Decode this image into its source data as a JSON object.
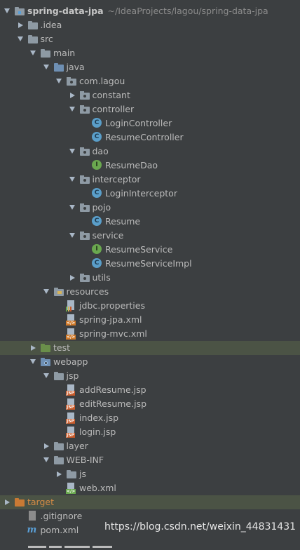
{
  "project": {
    "name": "spring-data-jpa",
    "path": "~/IdeaProjects/lagou/spring-data-jpa"
  },
  "items": [
    {
      "label": ".idea",
      "icon": "folder-icon",
      "expanded": false
    },
    {
      "label": "src",
      "icon": "folder-icon",
      "expanded": true
    },
    {
      "label": "main",
      "icon": "folder-icon",
      "expanded": true
    },
    {
      "label": "java",
      "icon": "source-folder-icon",
      "expanded": true
    },
    {
      "label": "com.lagou",
      "icon": "package-icon",
      "expanded": true
    },
    {
      "label": "constant",
      "icon": "package-icon",
      "expanded": false
    },
    {
      "label": "controller",
      "icon": "package-icon",
      "expanded": true
    },
    {
      "label": "LoginController",
      "icon": "class-icon",
      "badge": "C"
    },
    {
      "label": "ResumeController",
      "icon": "class-icon",
      "badge": "C"
    },
    {
      "label": "dao",
      "icon": "package-icon",
      "expanded": true
    },
    {
      "label": "ResumeDao",
      "icon": "interface-icon",
      "badge": "I"
    },
    {
      "label": "interceptor",
      "icon": "package-icon",
      "expanded": true
    },
    {
      "label": "LoginInterceptor",
      "icon": "class-icon",
      "badge": "C"
    },
    {
      "label": "pojo",
      "icon": "package-icon",
      "expanded": true
    },
    {
      "label": "Resume",
      "icon": "class-icon",
      "badge": "C"
    },
    {
      "label": "service",
      "icon": "package-icon",
      "expanded": true
    },
    {
      "label": "ResumeService",
      "icon": "interface-icon",
      "badge": "I"
    },
    {
      "label": "ResumeServiceImpl",
      "icon": "class-icon",
      "badge": "C"
    },
    {
      "label": "utils",
      "icon": "package-icon",
      "expanded": false
    },
    {
      "label": "resources",
      "icon": "resources-folder-icon",
      "expanded": true
    },
    {
      "label": "jdbc.properties",
      "icon": "properties-file-icon"
    },
    {
      "label": "spring-jpa.xml",
      "icon": "spring-xml-file-icon",
      "tag": "</>"
    },
    {
      "label": "spring-mvc.xml",
      "icon": "spring-xml-file-icon",
      "tag": "</>"
    },
    {
      "label": "test",
      "icon": "test-folder-icon",
      "expanded": false
    },
    {
      "label": "webapp",
      "icon": "web-folder-icon",
      "expanded": true
    },
    {
      "label": "jsp",
      "icon": "folder-icon",
      "expanded": true
    },
    {
      "label": "addResume.jsp",
      "icon": "jsp-file-icon",
      "tag": "JSP"
    },
    {
      "label": "editResume.jsp",
      "icon": "jsp-file-icon",
      "tag": "JSP"
    },
    {
      "label": "index.jsp",
      "icon": "jsp-file-icon",
      "tag": "JSP"
    },
    {
      "label": "login.jsp",
      "icon": "jsp-file-icon",
      "tag": "JSP"
    },
    {
      "label": "layer",
      "icon": "folder-icon",
      "expanded": false
    },
    {
      "label": "WEB-INF",
      "icon": "folder-icon",
      "expanded": true
    },
    {
      "label": "js",
      "icon": "folder-icon",
      "expanded": false
    },
    {
      "label": "web.xml",
      "icon": "web-xml-file-icon",
      "tag": "</>"
    },
    {
      "label": "target",
      "icon": "excluded-folder-icon",
      "expanded": false
    },
    {
      "label": ".gitignore",
      "icon": "gitignore-file-icon"
    },
    {
      "label": "pom.xml",
      "icon": "maven-pom-icon",
      "badge": "m"
    }
  ],
  "watermark": "https://blog.csdn.net/weixin_44831431",
  "colors": {
    "background": "#3c3f41",
    "selection": "#4b5345",
    "text": "#bbbbbb",
    "excluded": "#d28a45",
    "class_icon": "#5a9ec9",
    "interface_icon": "#6aa84f"
  }
}
